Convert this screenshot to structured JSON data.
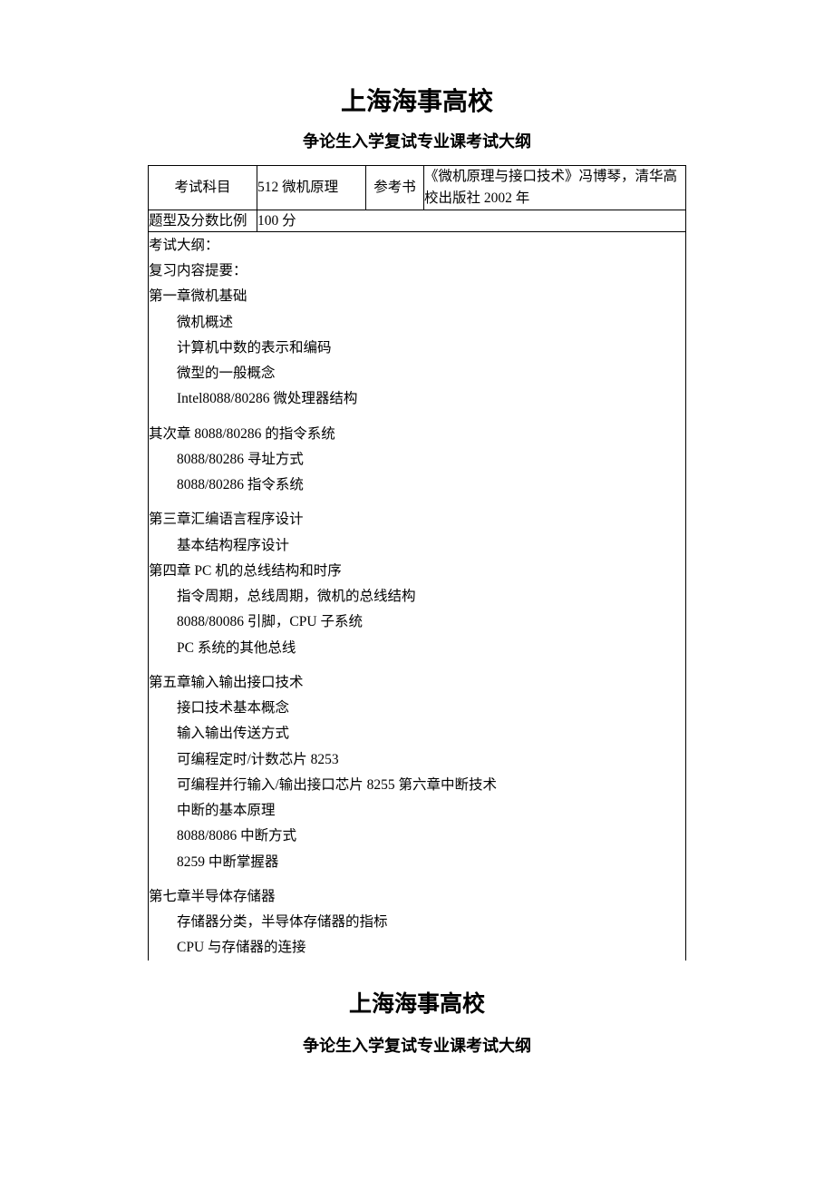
{
  "header": {
    "title": "上海海事高校",
    "subtitle": "争论生入学复试专业课考试大纲"
  },
  "row1": {
    "subject_label": "考试科目",
    "subject_value": "512 微机原理",
    "ref_label": "参考书",
    "ref_value": "《微机原理与接口技术》冯博琴，清华高校出版社 2002 年"
  },
  "row2": {
    "score_label": "题型及分数比例",
    "score_value": "100 分"
  },
  "content": {
    "l01": "考试大纲：",
    "l02": "复习内容提要：",
    "l03": "第一章微机基础",
    "l04": "微机概述",
    "l05": "计算机中数的表示和编码",
    "l06": "微型的一般概念",
    "l07": "Intel8088/80286 微处理器结构",
    "l08": "其次章 8088/80286 的指令系统",
    "l09": "8088/80286 寻址方式",
    "l10": "8088/80286 指令系统",
    "l11": "第三章汇编语言程序设计",
    "l12": "基本结构程序设计",
    "l13": "第四章 PC 机的总线结构和时序",
    "l14": "指令周期，总线周期，微机的总线结构",
    "l15": "8088/80086 引脚，CPU 子系统",
    "l16": " PC 系统的其他总线",
    "l17": "第五章输入输出接口技术",
    "l18": "接口技术基本概念",
    "l19": "输入输出传送方式",
    "l20": "可编程定时/计数芯片 8253",
    "l21": "可编程并行输入/输出接口芯片 8255 第六章中断技术",
    "l22": " 中断的基本原理",
    "l23": "8088/8086 中断方式",
    "l24": "8259 中断掌握器",
    "l25": "第七章半导体存储器",
    "l26": "存储器分类，半导体存储器的指标",
    "l27": " CPU 与存储器的连接"
  },
  "footer": {
    "title": "上海海事高校",
    "subtitle": "争论生入学复试专业课考试大纲"
  }
}
